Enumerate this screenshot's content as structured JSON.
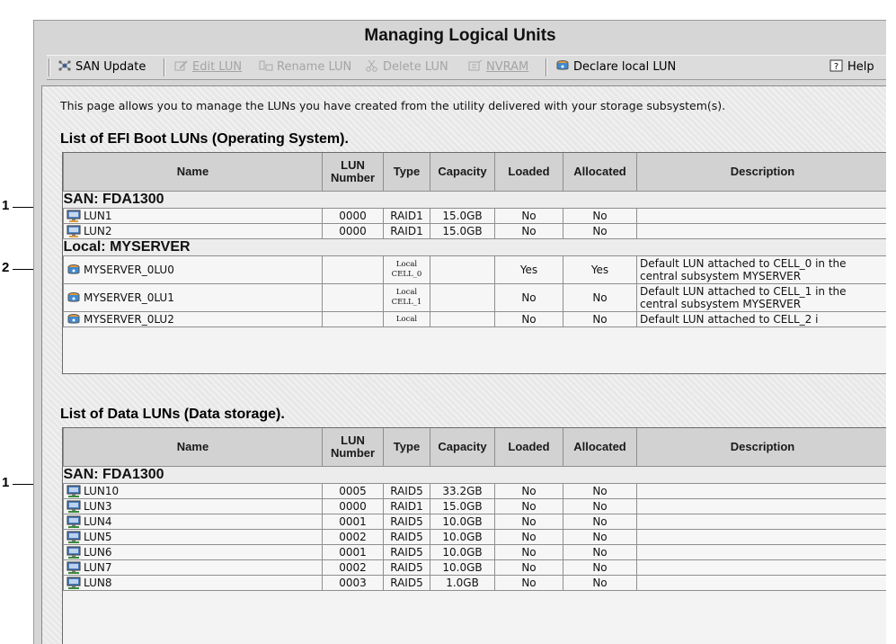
{
  "window": {
    "title": "Managing Logical Units"
  },
  "toolbar": {
    "san_update": "SAN Update",
    "edit_lun": "Edit LUN",
    "rename_lun": "Rename LUN",
    "delete_lun": "Delete LUN",
    "nvram": "NVRAM",
    "declare_local": "Declare local LUN",
    "help": "Help"
  },
  "intro": "This page allows you to manage the LUNs you have created from the utility delivered with your storage subsystem(s).",
  "callouts": [
    "1",
    "2",
    "1"
  ],
  "columns": {
    "name": "Name",
    "lun_number": "LUN Number",
    "type": "Type",
    "capacity": "Capacity",
    "loaded": "Loaded",
    "allocated": "Allocated",
    "description": "Description"
  },
  "efi": {
    "title": "List of EFI Boot LUNs (Operating System).",
    "san_group": "SAN: FDA1300",
    "san_rows": [
      {
        "name": "LUN1",
        "num": "0000",
        "type": "RAID1",
        "cap": "15.0GB",
        "loaded": "No",
        "alloc": "No",
        "desc": ""
      },
      {
        "name": "LUN2",
        "num": "0000",
        "type": "RAID1",
        "cap": "15.0GB",
        "loaded": "No",
        "alloc": "No",
        "desc": ""
      }
    ],
    "local_group": "Local: MYSERVER",
    "local_rows": [
      {
        "name": "MYSERVER_0LU0",
        "num": "",
        "type1": "Local",
        "type2": "CELL_0",
        "cap": "",
        "loaded": "Yes",
        "alloc": "Yes",
        "desc": "Default LUN attached to CELL_0 in the central subsystem MYSERVER"
      },
      {
        "name": "MYSERVER_0LU1",
        "num": "",
        "type1": "Local",
        "type2": "CELL_1",
        "cap": "",
        "loaded": "No",
        "alloc": "No",
        "desc": "Default LUN attached to CELL_1 in the central subsystem MYSERVER"
      },
      {
        "name": "MYSERVER_0LU2",
        "num": "",
        "type1": "Local",
        "type2": "",
        "cap": "",
        "loaded": "No",
        "alloc": "No",
        "desc": "Default LUN attached to CELL_2 i"
      }
    ]
  },
  "data": {
    "title": "List of Data LUNs (Data storage).",
    "san_group": "SAN: FDA1300",
    "rows": [
      {
        "name": "LUN10",
        "num": "0005",
        "type": "RAID5",
        "cap": "33.2GB",
        "loaded": "No",
        "alloc": "No",
        "desc": ""
      },
      {
        "name": "LUN3",
        "num": "0000",
        "type": "RAID1",
        "cap": "15.0GB",
        "loaded": "No",
        "alloc": "No",
        "desc": ""
      },
      {
        "name": "LUN4",
        "num": "0001",
        "type": "RAID5",
        "cap": "10.0GB",
        "loaded": "No",
        "alloc": "No",
        "desc": ""
      },
      {
        "name": "LUN5",
        "num": "0002",
        "type": "RAID5",
        "cap": "10.0GB",
        "loaded": "No",
        "alloc": "No",
        "desc": ""
      },
      {
        "name": "LUN6",
        "num": "0001",
        "type": "RAID5",
        "cap": "10.0GB",
        "loaded": "No",
        "alloc": "No",
        "desc": ""
      },
      {
        "name": "LUN7",
        "num": "0002",
        "type": "RAID5",
        "cap": "10.0GB",
        "loaded": "No",
        "alloc": "No",
        "desc": ""
      },
      {
        "name": "LUN8",
        "num": "0003",
        "type": "RAID5",
        "cap": "1.0GB",
        "loaded": "No",
        "alloc": "No",
        "desc": ""
      }
    ]
  },
  "icons": {
    "san_update": "network-update-icon",
    "edit": "edit-icon",
    "rename": "rename-icon",
    "delete": "scissors-icon",
    "nvram": "nvram-icon",
    "declare": "local-disk-icon",
    "help": "help-icon",
    "efi_lun": "boot-lun-icon",
    "local_lun": "local-disk-icon",
    "data_lun": "data-lun-icon"
  },
  "colors": {
    "window_bg": "#d6d6d6",
    "content_bg": "#ececec",
    "header_bg": "#d2d2d2",
    "disabled_text": "#a4a4a4"
  }
}
